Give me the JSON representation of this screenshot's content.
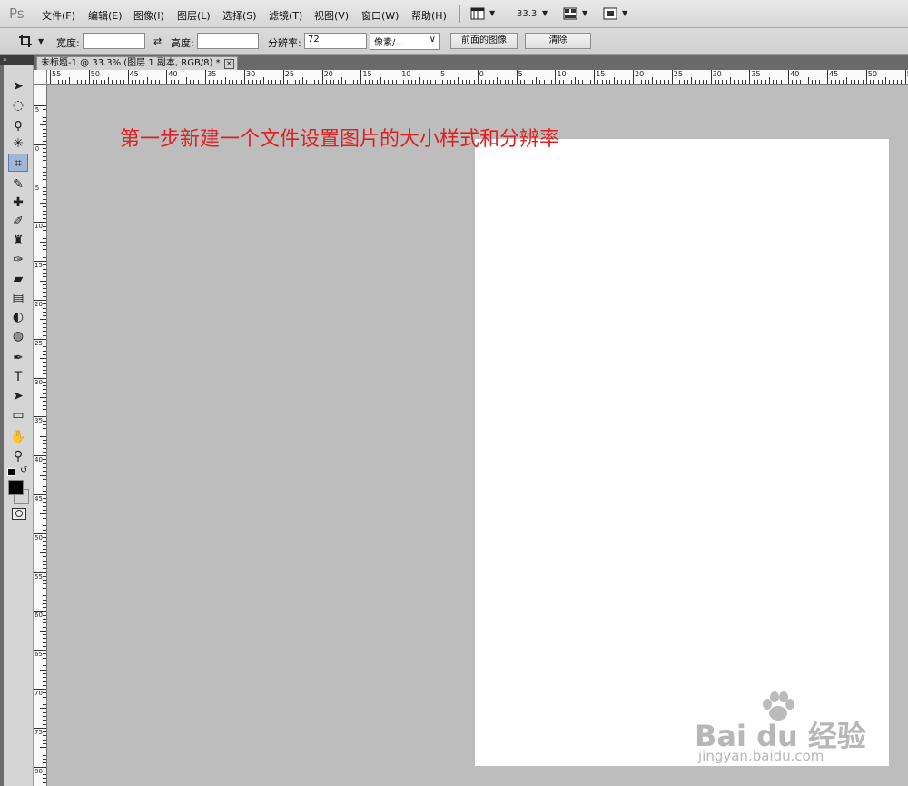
{
  "app": {
    "logo": "Ps"
  },
  "menu": {
    "items": [
      "文件(F)",
      "编辑(E)",
      "图像(I)",
      "图层(L)",
      "选择(S)",
      "滤镜(T)",
      "视图(V)",
      "窗口(W)",
      "帮助(H)"
    ],
    "zoom": "33.3"
  },
  "options": {
    "width_label": "宽度:",
    "width_value": "",
    "height_label": "高度:",
    "height_value": "",
    "resolution_label": "分辨率:",
    "resolution_value": "72",
    "unit_select": "像素/...",
    "front_image_button": "前面的图像",
    "clear_button": "清除"
  },
  "document": {
    "tab_title": "未标题-1 @ 33.3% (图层 1 副本, RGB/8) *"
  },
  "rulers": {
    "horizontal_labels": [
      "55",
      "50",
      "45",
      "40",
      "35",
      "30",
      "25",
      "20",
      "15",
      "10",
      "5",
      "0",
      "5",
      "10",
      "15",
      "20",
      "25",
      "30",
      "35",
      "40",
      "45",
      "50",
      "55"
    ],
    "vertical_labels": [
      "5",
      "0",
      "5",
      "10",
      "15",
      "20",
      "25",
      "30",
      "35",
      "40",
      "45",
      "50",
      "55",
      "60",
      "65",
      "70",
      "75",
      "80"
    ]
  },
  "canvas": {
    "annotation": "第一步新建一个文件设置图片的大小样式和分辨率"
  },
  "watermark": {
    "main": "Bai du 经验",
    "sub": "jingyan.baidu.com"
  },
  "tools": [
    {
      "name": "move-tool-icon",
      "glyph": "➤"
    },
    {
      "name": "marquee-tool-icon",
      "glyph": "◌"
    },
    {
      "name": "lasso-tool-icon",
      "glyph": "ϙ"
    },
    {
      "name": "quick-select-tool-icon",
      "glyph": "✳"
    },
    {
      "name": "crop-tool-icon",
      "glyph": "⌗"
    },
    {
      "name": "eyedropper-tool-icon",
      "glyph": "✎"
    },
    {
      "name": "healing-brush-tool-icon",
      "glyph": "✚"
    },
    {
      "name": "brush-tool-icon",
      "glyph": "✐"
    },
    {
      "name": "clone-stamp-tool-icon",
      "glyph": "♜"
    },
    {
      "name": "history-brush-tool-icon",
      "glyph": "✑"
    },
    {
      "name": "eraser-tool-icon",
      "glyph": "▰"
    },
    {
      "name": "gradient-tool-icon",
      "glyph": "▤"
    },
    {
      "name": "blur-tool-icon",
      "glyph": "◐"
    },
    {
      "name": "dodge-tool-icon",
      "glyph": "◍"
    },
    {
      "name": "pen-tool-icon",
      "glyph": "✒"
    },
    {
      "name": "type-tool-icon",
      "glyph": "T"
    },
    {
      "name": "path-select-tool-icon",
      "glyph": "➤"
    },
    {
      "name": "shape-tool-icon",
      "glyph": "▭"
    },
    {
      "name": "hand-tool-icon",
      "glyph": "✋"
    },
    {
      "name": "zoom-tool-icon",
      "glyph": "⚲"
    }
  ],
  "colors": {
    "foreground": "#000000",
    "background": "#ffffff",
    "annotation": "#e02020"
  }
}
